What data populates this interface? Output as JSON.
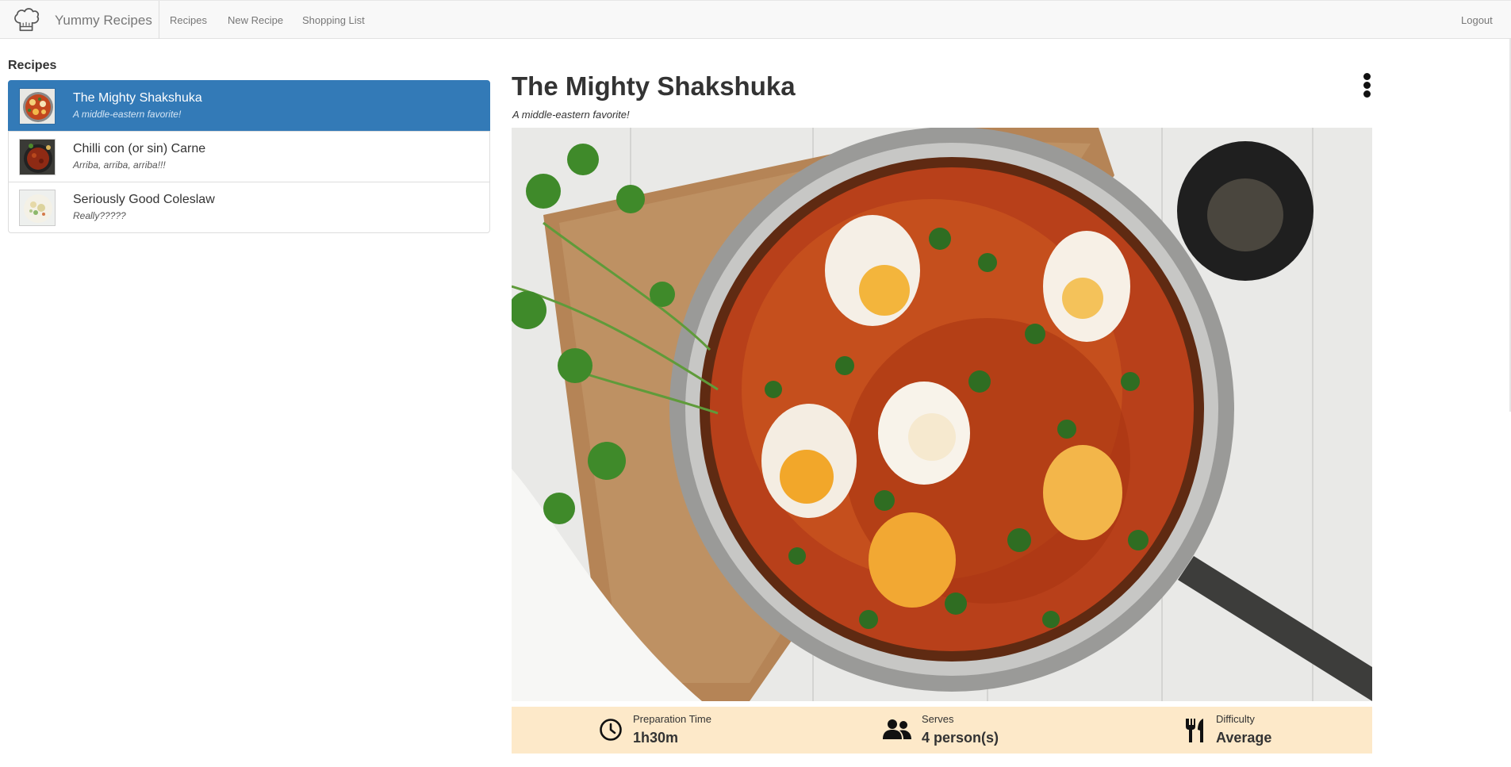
{
  "app": {
    "brand": "Yummy Recipes",
    "nav": {
      "recipes": "Recipes",
      "new_recipe": "New Recipe",
      "shopping_list": "Shopping List",
      "logout": "Logout"
    }
  },
  "sidebar": {
    "title": "Recipes",
    "items": [
      {
        "name": "The Mighty Shakshuka",
        "description": "A middle-eastern favorite!",
        "active": true
      },
      {
        "name": "Chilli con (or sin) Carne",
        "description": "Arriba, arriba, arriba!!!",
        "active": false
      },
      {
        "name": "Seriously Good Coleslaw",
        "description": "Really?????",
        "active": false
      }
    ]
  },
  "detail": {
    "title": "The Mighty Shakshuka",
    "subtitle": "A middle-eastern favorite!",
    "info": {
      "prep_label": "Preparation Time",
      "prep_value": "1h30m",
      "serves_label": "Serves",
      "serves_value": "4 person(s)",
      "difficulty_label": "Difficulty",
      "difficulty_value": "Average"
    }
  },
  "colors": {
    "accent": "#337ab7",
    "info_bar": "#fde9c9",
    "navbar": "#f8f8f8"
  }
}
